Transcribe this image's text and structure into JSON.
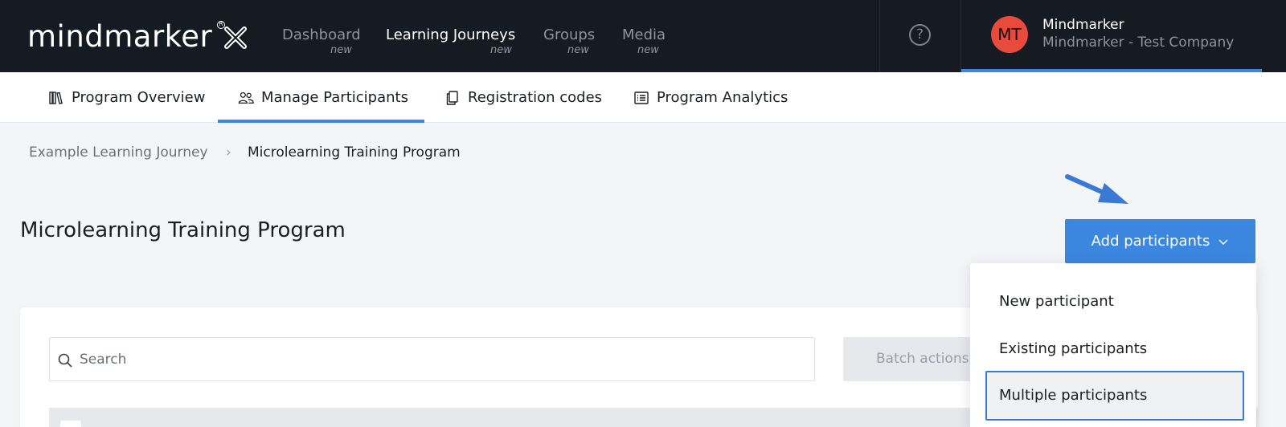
{
  "header": {
    "logo_text": "mindmarker",
    "nav": [
      {
        "label": "Dashboard",
        "sub": "new"
      },
      {
        "label": "Learning Journeys",
        "sub": "new"
      },
      {
        "label": "Groups",
        "sub": "new"
      },
      {
        "label": "Media",
        "sub": "new"
      }
    ],
    "help_icon": "?",
    "user": {
      "initials": "MT",
      "name": "Mindmarker",
      "company": "Mindmarker - Test Company"
    }
  },
  "subnav": {
    "tabs": [
      {
        "label": "Program Overview",
        "icon": "books-icon"
      },
      {
        "label": "Manage Participants",
        "icon": "users-icon"
      },
      {
        "label": "Registration codes",
        "icon": "copy-icon"
      },
      {
        "label": "Program Analytics",
        "icon": "list-icon"
      }
    ],
    "active_tab": "Manage Participants"
  },
  "breadcrumb": {
    "parent": "Example Learning Journey",
    "separator": "›",
    "current": "Microlearning Training Program"
  },
  "page": {
    "title": "Microlearning Training Program"
  },
  "actions": {
    "add_label": "Add participants",
    "batch_label": "Batch actions"
  },
  "search": {
    "placeholder": "Search"
  },
  "dropdown": {
    "items": [
      "New participant",
      "Existing participants",
      "Multiple participants"
    ],
    "highlighted": "Multiple participants"
  },
  "colors": {
    "accent": "#3b87e0",
    "topbar": "#161a23",
    "avatar": "#e84b3c",
    "arrow": "#3b7ad4"
  }
}
